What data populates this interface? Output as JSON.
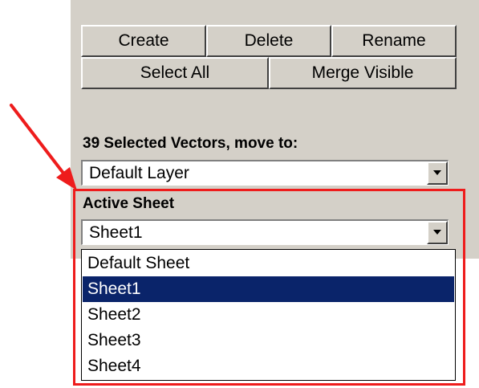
{
  "buttons": {
    "create": "Create",
    "delete": "Delete",
    "rename": "Rename",
    "select_all": "Select All",
    "merge_visible": "Merge Visible"
  },
  "move_to": {
    "label": "39 Selected Vectors, move to:",
    "value": "Default Layer"
  },
  "active_sheet": {
    "label": "Active Sheet",
    "value": "Sheet1",
    "options": [
      {
        "label": "Default Sheet",
        "selected": false
      },
      {
        "label": "Sheet1",
        "selected": true
      },
      {
        "label": "Sheet2",
        "selected": false
      },
      {
        "label": "Sheet3",
        "selected": false
      },
      {
        "label": "Sheet4",
        "selected": false
      }
    ]
  },
  "colors": {
    "panel_bg": "#d4d0c8",
    "selection_bg": "#0a246a",
    "annotation_red": "#ee1c1c"
  }
}
